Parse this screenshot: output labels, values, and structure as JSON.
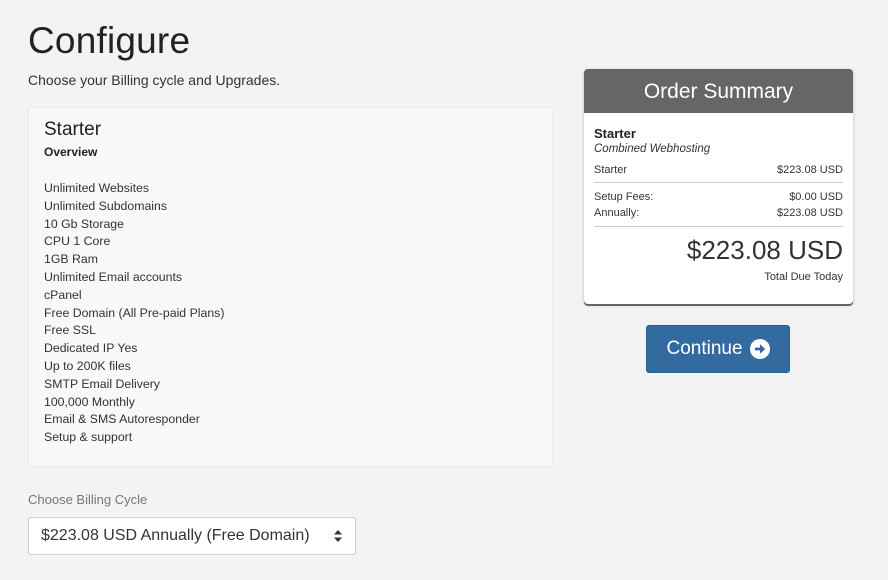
{
  "page": {
    "title": "Configure",
    "subtitle": "Choose your Billing cycle and Upgrades."
  },
  "product": {
    "name": "Starter",
    "overview_label": "Overview",
    "features": [
      "Unlimited Websites",
      "Unlimited Subdomains",
      "10 Gb Storage",
      "CPU 1 Core",
      "1GB Ram",
      "Unlimited Email accounts",
      "cPanel",
      "Free Domain (All Pre-paid Plans)",
      "Free SSL",
      "Dedicated IP Yes",
      "Up to 200K files",
      "SMTP Email Delivery",
      "100,000 Monthly",
      "Email & SMS Autoresponder",
      "Setup & support"
    ]
  },
  "billing": {
    "label": "Choose Billing Cycle",
    "selected": "$223.08 USD Annually (Free Domain)",
    "icon": "updown-arrows-icon"
  },
  "summary": {
    "header": "Order Summary",
    "product_name": "Starter",
    "product_group": "Combined Webhosting",
    "line_item": {
      "label": "Starter",
      "value": "$223.08 USD"
    },
    "setup_fees": {
      "label": "Setup Fees:",
      "value": "$0.00 USD"
    },
    "recurring": {
      "label": "Annually:",
      "value": "$223.08 USD"
    },
    "total": "$223.08 USD",
    "total_label": "Total Due Today"
  },
  "actions": {
    "continue_label": "Continue",
    "continue_icon": "arrow-circle-right-icon"
  },
  "colors": {
    "background": "#f3f3f3",
    "summary_header": "#666666",
    "continue_button": "#336aa0"
  }
}
